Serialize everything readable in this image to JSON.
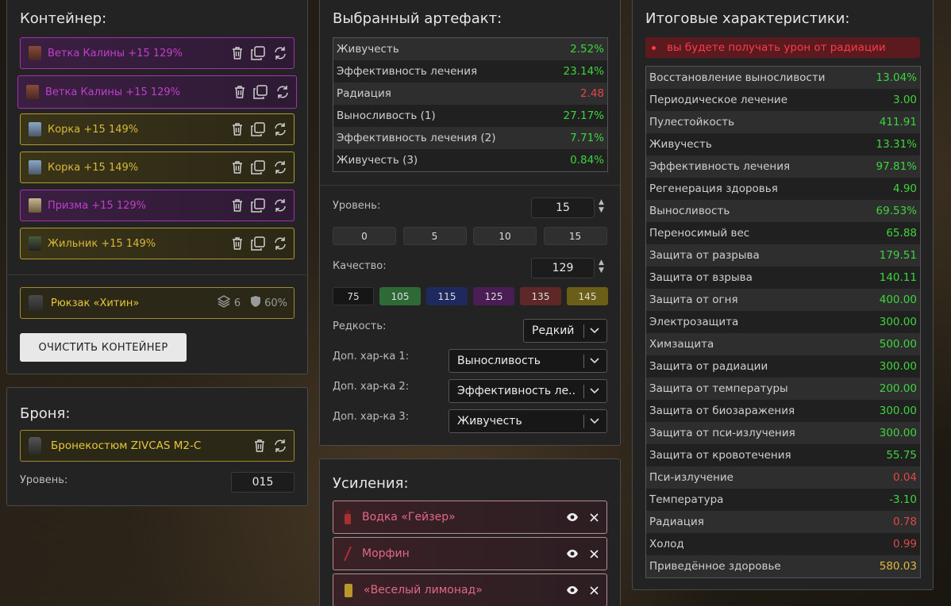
{
  "container": {
    "title": "Контейнер:",
    "slots": [
      {
        "label": "Ветка Калины +15 129%",
        "tier": "purple",
        "icon": "branch-artifact-icon"
      },
      {
        "label": "Ветка Калины +15 129%",
        "tier": "purple",
        "icon": "branch-artifact-icon"
      },
      {
        "label": "Корка +15 149%",
        "tier": "gold",
        "icon": "crust-artifact-icon"
      },
      {
        "label": "Корка +15 149%",
        "tier": "gold",
        "icon": "crust-artifact-icon"
      },
      {
        "label": "Призма +15 129%",
        "tier": "purple",
        "icon": "prism-artifact-icon"
      },
      {
        "label": "Жильник +15 149%",
        "tier": "gold",
        "icon": "vein-artifact-icon"
      }
    ],
    "backpack": {
      "label": "Рюкзак «Хитин»",
      "slots": "6",
      "protection": "60%"
    },
    "clear_button": "ОЧИСТИТЬ КОНТЕЙНЕР"
  },
  "armor": {
    "title": "Броня:",
    "item": "Бронекостюм ZIVCAS M2-C",
    "level_label": "Уровень:",
    "level_value": "015"
  },
  "selected": {
    "title": "Выбранный артефакт:",
    "stats": [
      {
        "name": "Живучесть",
        "value": "2.52%",
        "color": "green"
      },
      {
        "name": "Эффективность лечения",
        "value": "23.14%",
        "color": "green"
      },
      {
        "name": "Радиация",
        "value": "2.48",
        "color": "red"
      },
      {
        "name": "Выносливость (1)",
        "value": "27.17%",
        "color": "green"
      },
      {
        "name": "Эффективность лечения (2)",
        "value": "7.71%",
        "color": "green"
      },
      {
        "name": "Живучесть (3)",
        "value": "0.84%",
        "color": "green"
      }
    ],
    "level_label": "Уровень:",
    "level_value": "15",
    "level_presets": [
      "0",
      "5",
      "10",
      "15"
    ],
    "quality_label": "Качество:",
    "quality_value": "129",
    "quality_presets": [
      {
        "label": "75",
        "color": "#161616"
      },
      {
        "label": "105",
        "color": "#2d6a35"
      },
      {
        "label": "115",
        "color": "#1e2a5e"
      },
      {
        "label": "125",
        "color": "#4a1d55"
      },
      {
        "label": "135",
        "color": "#5e2828"
      },
      {
        "label": "145",
        "color": "#6b5e18"
      }
    ],
    "rarity_label": "Редкость:",
    "rarity_value": "Редкий",
    "extra1_label": "Доп. хар-ка 1:",
    "extra1_value": "Выносливость",
    "extra2_label": "Доп. хар-ка 2:",
    "extra2_value": "Эффективность ле...",
    "extra3_label": "Доп. хар-ка 3:",
    "extra3_value": "Живучесть"
  },
  "boosts": {
    "title": "Усиления:",
    "items": [
      {
        "label": "Водка «Гейзер»",
        "icon": "vodka-bottle-icon"
      },
      {
        "label": "Морфин",
        "icon": "syringe-icon"
      },
      {
        "label": "«Веселый лимонад»",
        "icon": "lemonade-can-icon"
      }
    ]
  },
  "totals": {
    "title": "Итоговые характеристики:",
    "warning": "вы будете получать урон от радиации",
    "stats": [
      {
        "name": "Восстановление выносливости",
        "value": "13.04%",
        "color": "green"
      },
      {
        "name": "Периодическое лечение",
        "value": "3.00",
        "color": "green"
      },
      {
        "name": "Пулестойкость",
        "value": "411.91",
        "color": "green"
      },
      {
        "name": "Живучесть",
        "value": "13.31%",
        "color": "green"
      },
      {
        "name": "Эффективность лечения",
        "value": "97.81%",
        "color": "green"
      },
      {
        "name": "Регенерация здоровья",
        "value": "4.90",
        "color": "green"
      },
      {
        "name": "Выносливость",
        "value": "69.53%",
        "color": "green"
      },
      {
        "name": "Переносимый вес",
        "value": "65.88",
        "color": "green"
      },
      {
        "name": "Защита от разрыва",
        "value": "179.51",
        "color": "green"
      },
      {
        "name": "Защита от взрыва",
        "value": "140.11",
        "color": "green"
      },
      {
        "name": "Защита от огня",
        "value": "400.00",
        "color": "green"
      },
      {
        "name": "Электрозащита",
        "value": "300.00",
        "color": "green"
      },
      {
        "name": "Химзащита",
        "value": "500.00",
        "color": "green"
      },
      {
        "name": "Защита от радиации",
        "value": "300.00",
        "color": "green"
      },
      {
        "name": "Защита от температуры",
        "value": "200.00",
        "color": "green"
      },
      {
        "name": "Защита от биозаражения",
        "value": "300.00",
        "color": "green"
      },
      {
        "name": "Защита от пси-излучения",
        "value": "300.00",
        "color": "green"
      },
      {
        "name": "Защита от кровотечения",
        "value": "55.75",
        "color": "green"
      },
      {
        "name": "Пси-излучение",
        "value": "0.04",
        "color": "red"
      },
      {
        "name": "Температура",
        "value": "-3.10",
        "color": "green"
      },
      {
        "name": "Радиация",
        "value": "0.78",
        "color": "red"
      },
      {
        "name": "Холод",
        "value": "0.99",
        "color": "red"
      },
      {
        "name": "Приведённое здоровье",
        "value": "580.03",
        "color": "gold"
      }
    ]
  }
}
